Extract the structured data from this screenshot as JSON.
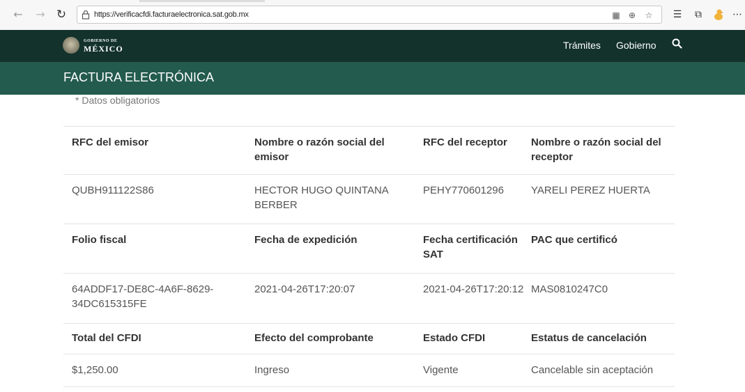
{
  "browser": {
    "url": "https://verificacfdi.facturaelectronica.sat.gob.mx",
    "icons": [
      "back-icon",
      "forward-icon",
      "reload-icon",
      "lock-icon",
      "qr-icon",
      "zoom-icon",
      "favorite-icon",
      "favorites-list-icon",
      "collections-icon",
      "profile-icon",
      "more-icon"
    ]
  },
  "gov_header": {
    "logo_small": "GOBIERNO DE",
    "logo_big": "MÉXICO",
    "links": [
      "Trámites",
      "Gobierno"
    ]
  },
  "subheader": {
    "title": "FACTURA ELECTRÓNICA"
  },
  "note": "* Datos obligatorios",
  "table": {
    "rows": [
      {
        "type": "head",
        "cells": [
          "RFC del emisor",
          "Nombre o razón social del emisor",
          "RFC del receptor",
          "Nombre o razón social del receptor"
        ]
      },
      {
        "type": "data",
        "cells": [
          "QUBH911122S86",
          "HECTOR HUGO QUINTANA BERBER",
          "PEHY770601296",
          "YARELI PEREZ HUERTA"
        ]
      },
      {
        "type": "head",
        "cells": [
          "Folio fiscal",
          "Fecha de expedición",
          "Fecha certificación SAT",
          "PAC que certificó"
        ]
      },
      {
        "type": "data",
        "cells": [
          "64ADDF17-DE8C-4A6F-8629-34DC615315FE",
          "2021-04-26T17:20:07",
          "2021-04-26T17:20:12",
          "MAS0810247C0"
        ]
      },
      {
        "type": "head",
        "cells": [
          "Total del CFDI",
          "Efecto del comprobante",
          "Estado CFDI",
          "Estatus de cancelación"
        ]
      },
      {
        "type": "data",
        "cells": [
          "$1,250.00",
          "Ingreso",
          "Vigente",
          "Cancelable sin aceptación"
        ]
      }
    ]
  }
}
